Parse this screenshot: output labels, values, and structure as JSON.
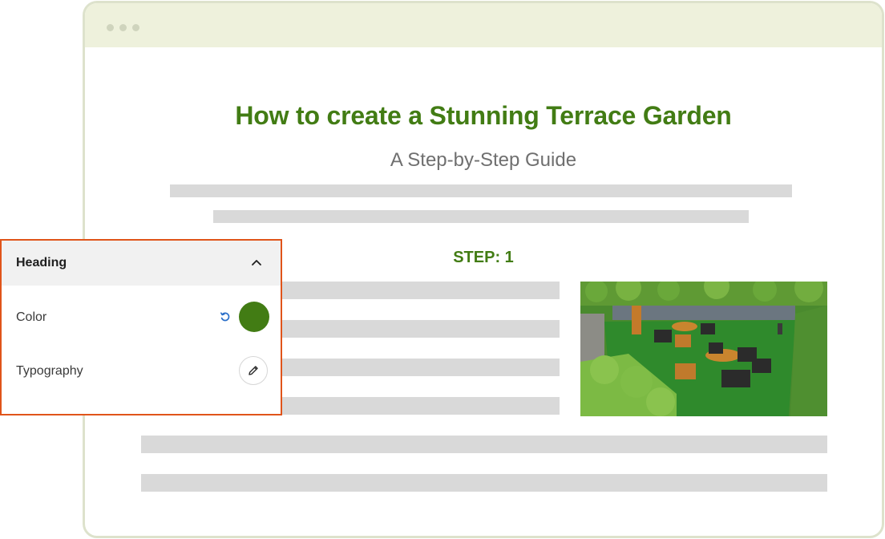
{
  "article": {
    "title": "How to create a Stunning Terrace Garden",
    "subtitle": "A Step-by-Step Guide",
    "step_label": "STEP: 1"
  },
  "panel": {
    "title": "Heading",
    "rows": [
      {
        "label": "Color"
      },
      {
        "label": "Typography"
      }
    ]
  },
  "colors": {
    "accent": "#427c14",
    "panel_border": "#e0541a",
    "frame": "#dde2cc",
    "titlebar": "#eef1dc"
  },
  "icons": [
    "chevron-up-icon",
    "reset-icon",
    "pencil-icon"
  ]
}
